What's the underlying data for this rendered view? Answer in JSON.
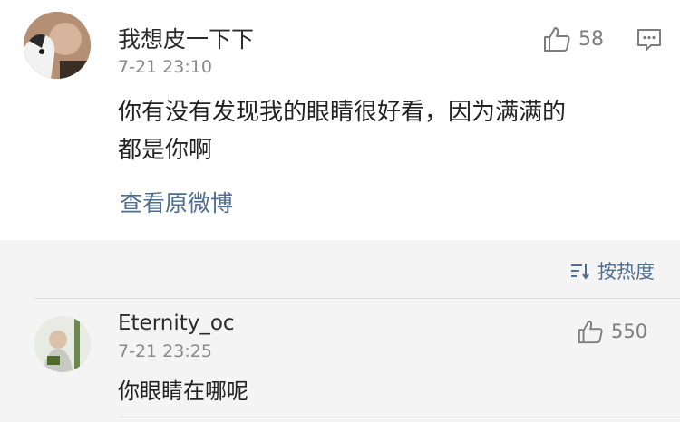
{
  "main_comment": {
    "username": "我想皮一下下",
    "timestamp": "7-21 23:10",
    "text_line1": "你有没有发现我的眼睛很好看，因为满满的",
    "text_line2": "都是你啊",
    "likes": "58",
    "view_link": "查看原微博",
    "like_icon": "thumbs-up-icon",
    "comment_icon": "comment-icon"
  },
  "replies": {
    "sort_label": "按热度",
    "sort_icon": "sort-icon",
    "items": [
      {
        "username": "Eternity_oc",
        "timestamp": "7-21 23:25",
        "text": "你眼睛在哪呢",
        "likes": "550"
      }
    ]
  },
  "colors": {
    "link": "#4d6d91",
    "reply_bg": "#f4f4f4"
  }
}
